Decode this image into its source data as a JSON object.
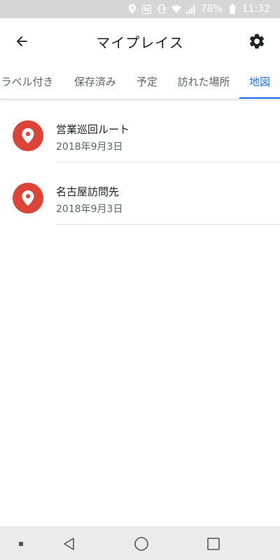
{
  "status_bar": {
    "battery_percent": "78%",
    "time": "11:32",
    "icons": [
      "location-icon",
      "nfc-icon",
      "vibrate-icon",
      "wifi-icon",
      "cell-signal-icon",
      "battery-icon"
    ]
  },
  "header": {
    "title": "マイプレイス",
    "back_icon": "arrow-back-icon",
    "settings_icon": "gear-icon"
  },
  "tabs": [
    {
      "label": "ラベル付き",
      "active": false
    },
    {
      "label": "保存済み",
      "active": false
    },
    {
      "label": "予定",
      "active": false
    },
    {
      "label": "訪れた場所",
      "active": false
    },
    {
      "label": "地図",
      "active": true
    }
  ],
  "maps": [
    {
      "title": "営業巡回ルート",
      "date": "2018年9月3日",
      "icon": "place-pin-icon"
    },
    {
      "title": "名古屋訪問先",
      "date": "2018年9月3日",
      "icon": "place-pin-icon"
    }
  ],
  "colors": {
    "accent": "#1a73e8",
    "pin_background": "#db4437",
    "status_bar": "#d6d6d6",
    "nav_bar": "#ebebeb"
  },
  "nav_bar": {
    "icons": [
      "menu-dot-icon",
      "back-triangle-icon",
      "home-circle-icon",
      "recents-square-icon"
    ]
  }
}
